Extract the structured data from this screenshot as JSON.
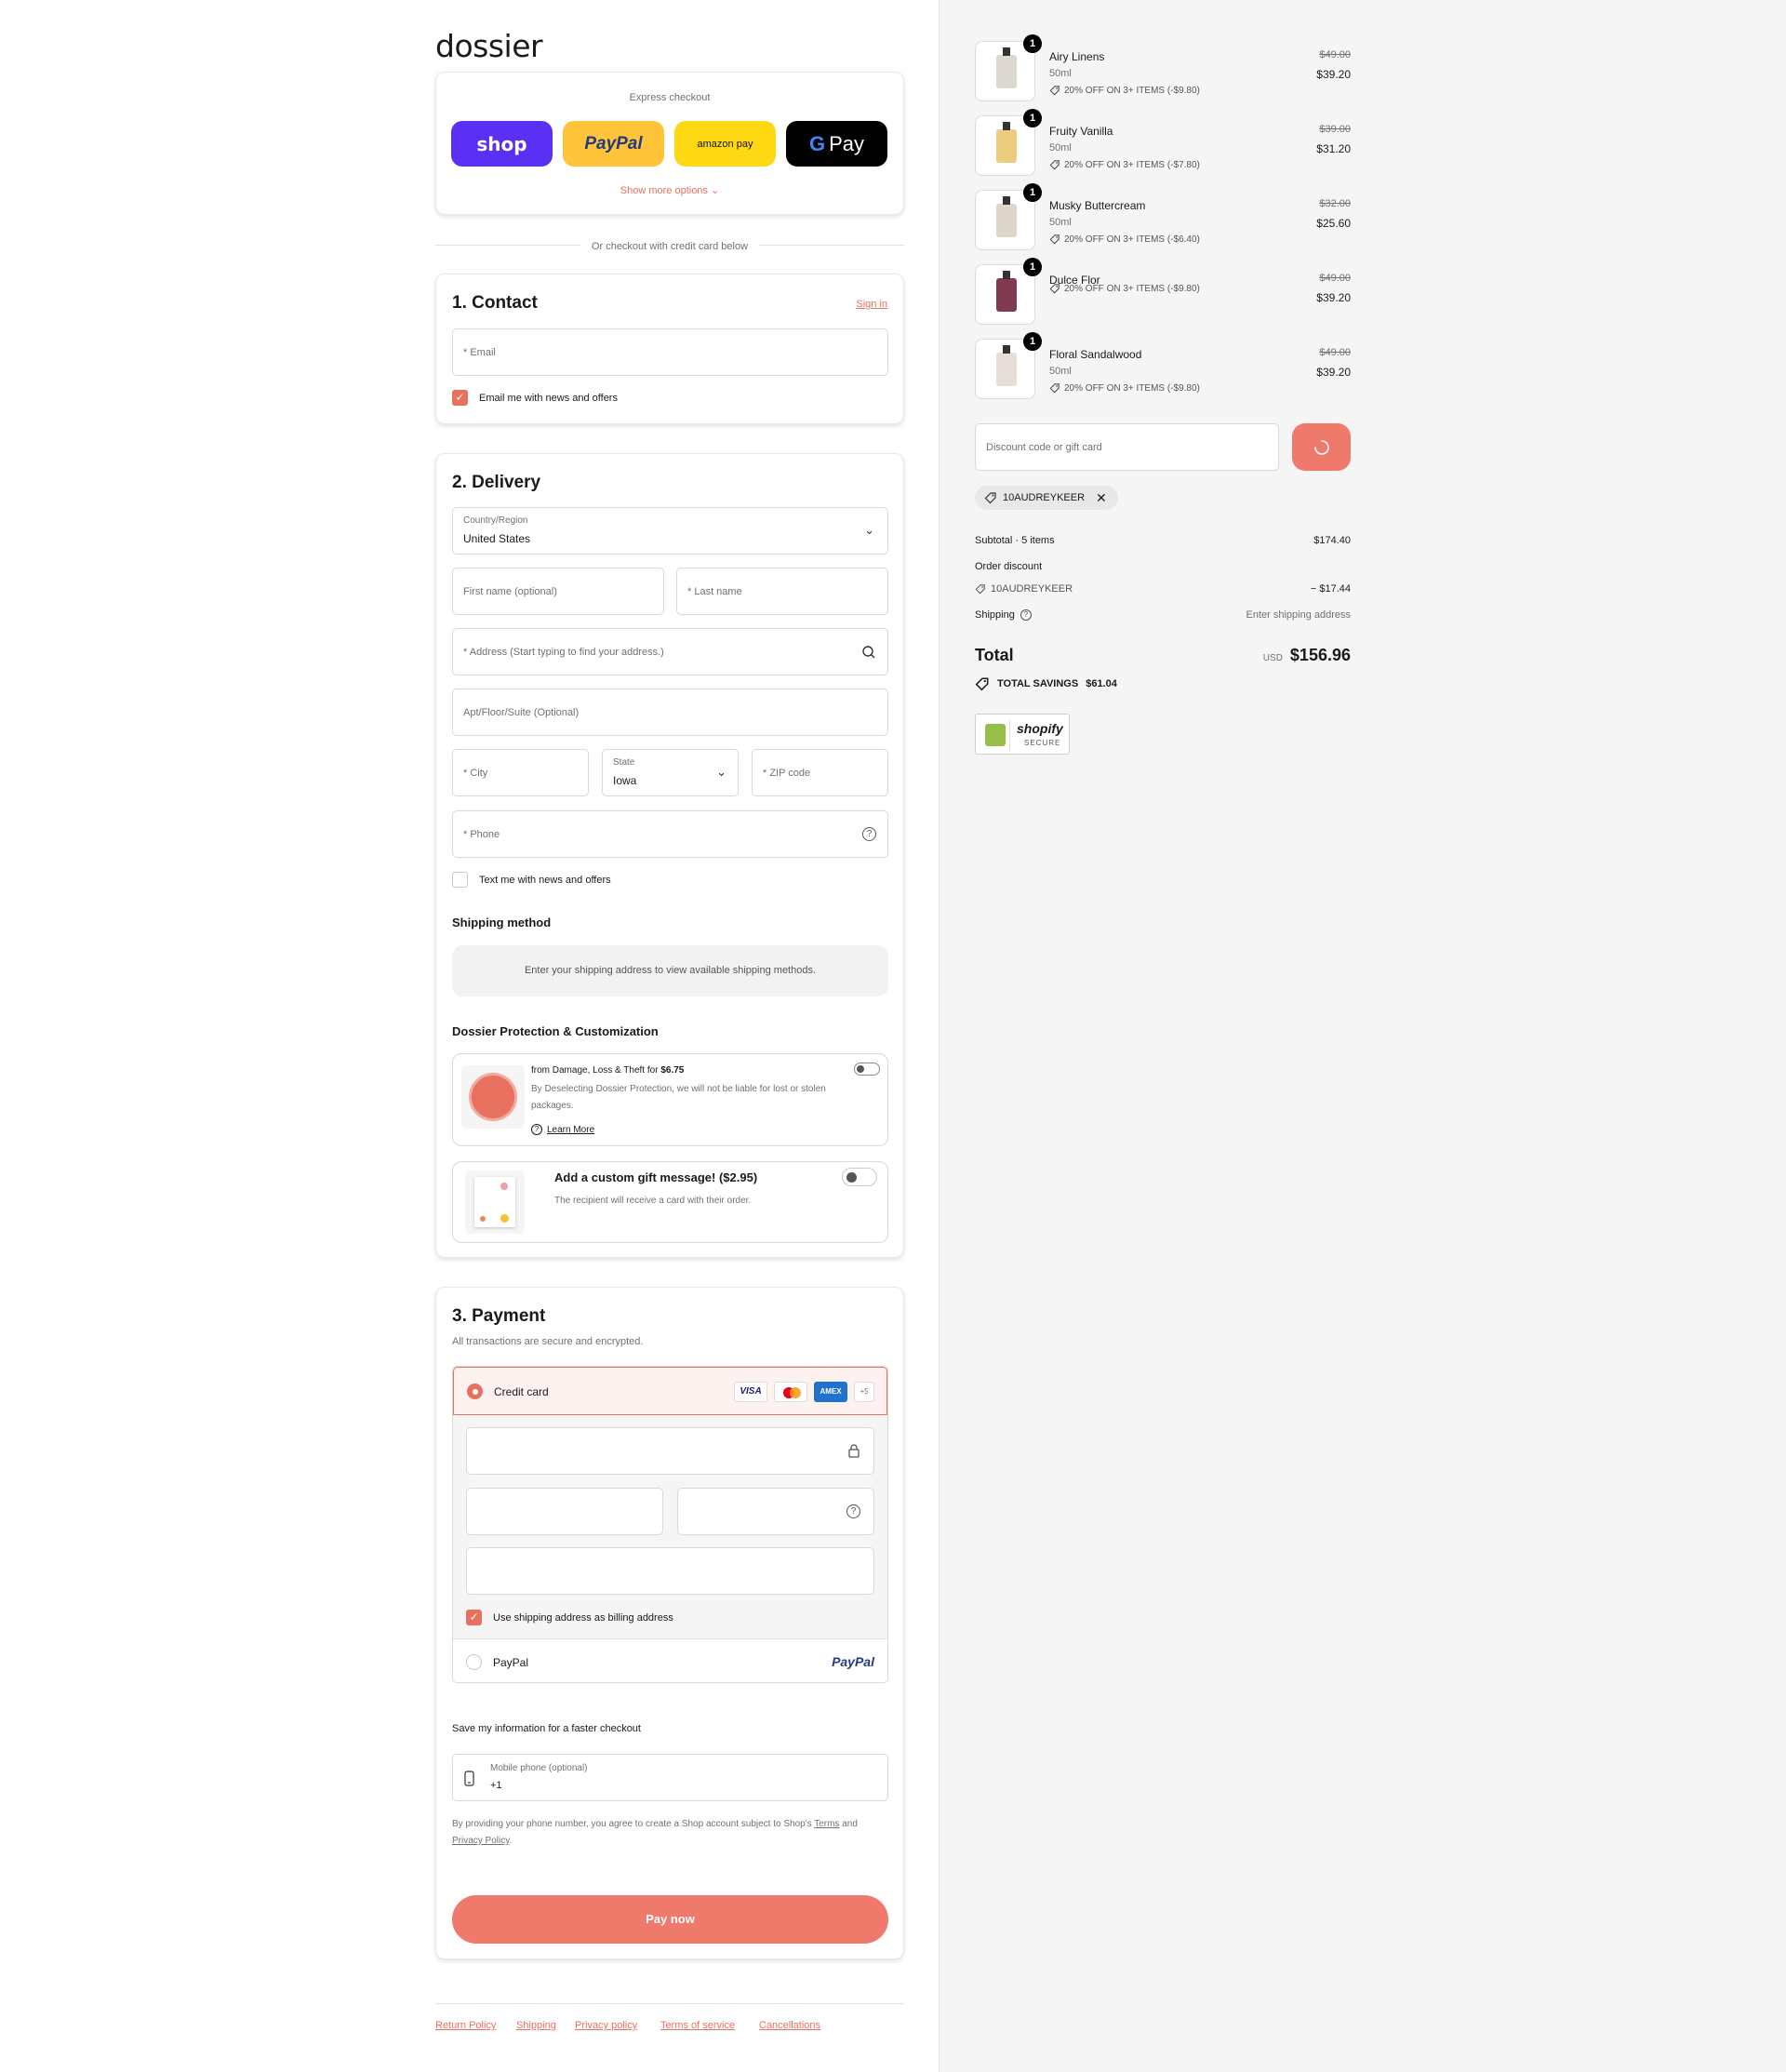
{
  "brand": {
    "logo": "dossier"
  },
  "express": {
    "title": "Express checkout",
    "shop": "shop",
    "paypal": "PayPal",
    "amazon": "amazon pay",
    "gpay": "Pay",
    "more": "Show more options"
  },
  "divider": "Or checkout with credit card below",
  "contact": {
    "title": "1. Contact",
    "signin": "Sign in",
    "email_placeholder": "* Email",
    "news_label": "Email me with news and offers"
  },
  "delivery": {
    "title": "2. Delivery",
    "country_label": "Country/Region",
    "country_value": "United States",
    "first_name": "First name (optional)",
    "last_name": "* Last name",
    "address": "* Address (Start typing to find your address.)",
    "apt": "Apt/Floor/Suite (Optional)",
    "city": "* City",
    "state_label": "State",
    "state_value": "Iowa",
    "zip": "* ZIP code",
    "phone": "* Phone",
    "text_label": "Text me with news and offers",
    "shipping_method_title": "Shipping method",
    "shipping_method_text": "Enter your shipping address to view available shipping methods.",
    "protection_title": "Dossier Protection & Customization",
    "protection_line1": "from Damage, Loss & Theft for ",
    "protection_price": "$6.75",
    "protection_desc": "By Deselecting Dossier Protection, we will not be liable for lost or stolen packages.",
    "learn_more": "Learn More",
    "gift_title": "Add a custom gift message! ($2.95)",
    "gift_desc": "The recipient will receive a card with their order."
  },
  "payment": {
    "title": "3. Payment",
    "subtitle": "All transactions are secure and encrypted.",
    "credit_card": "Credit card",
    "more_cards": "+5",
    "billing_label": "Use shipping address as billing address",
    "paypal": "PayPal",
    "paypal_logo": "PayPal",
    "save_title": "Save my information for a faster checkout",
    "mobile_label": "Mobile phone (optional)",
    "mobile_value": "+1",
    "terms_pre": "By providing your phone number, you agree to create a Shop account subject to Shop's ",
    "terms_link": "Terms",
    "terms_and": " and ",
    "privacy_link": "Privacy Policy",
    "terms_end": ".",
    "pay_now": "Pay now"
  },
  "footer": [
    "Return Policy",
    "Shipping",
    "Privacy policy",
    "Terms of service",
    "Cancellations"
  ],
  "items": [
    {
      "qty": "1",
      "name": "Airy Linens",
      "size": "50ml",
      "discount": "20% OFF ON 3+ ITEMS (-$9.80)",
      "old": "$49.00",
      "price": "$39.20",
      "color": "#d6d0c8"
    },
    {
      "qty": "1",
      "name": "Fruity Vanilla",
      "size": "50ml",
      "discount": "20% OFF ON 3+ ITEMS (-$7.80)",
      "old": "$39.00",
      "price": "$31.20",
      "color": "#e9c46a"
    },
    {
      "qty": "1",
      "name": "Musky Buttercream",
      "size": "50ml",
      "discount": "20% OFF ON 3+ ITEMS (-$6.40)",
      "old": "$32.00",
      "price": "$25.60",
      "color": "#d8cfc0"
    },
    {
      "qty": "1",
      "name": "Dulce Flor",
      "size": "",
      "discount": "20% OFF ON 3+ ITEMS (-$9.80)",
      "old": "$49.00",
      "price": "$39.20",
      "color": "#6b1830"
    },
    {
      "qty": "1",
      "name": "Floral Sandalwood",
      "size": "50ml",
      "discount": "20% OFF ON 3+ ITEMS (-$9.80)",
      "old": "$49.00",
      "price": "$39.20",
      "color": "#e3d8d4"
    }
  ],
  "discount": {
    "placeholder": "Discount code or gift card",
    "code": "10AUDREYKEER"
  },
  "summary": {
    "subtotal_label": "Subtotal · 5 items",
    "subtotal": "$174.40",
    "order_discount_label": "Order discount",
    "code": "10AUDREYKEER",
    "discount_value": "− $17.44",
    "shipping_label": "Shipping",
    "shipping_value": "Enter shipping address",
    "total_label": "Total",
    "currency": "USD",
    "total": "$156.96",
    "savings_label": "TOTAL SAVINGS",
    "savings": "$61.04"
  },
  "shopify": {
    "name": "shopify",
    "secure": "SECURE"
  },
  "colors": {
    "accent": "#e8705f",
    "shop": "#5a31f4",
    "paypal_yellow": "#ffc439",
    "amazon_yellow": "#ffd814"
  }
}
